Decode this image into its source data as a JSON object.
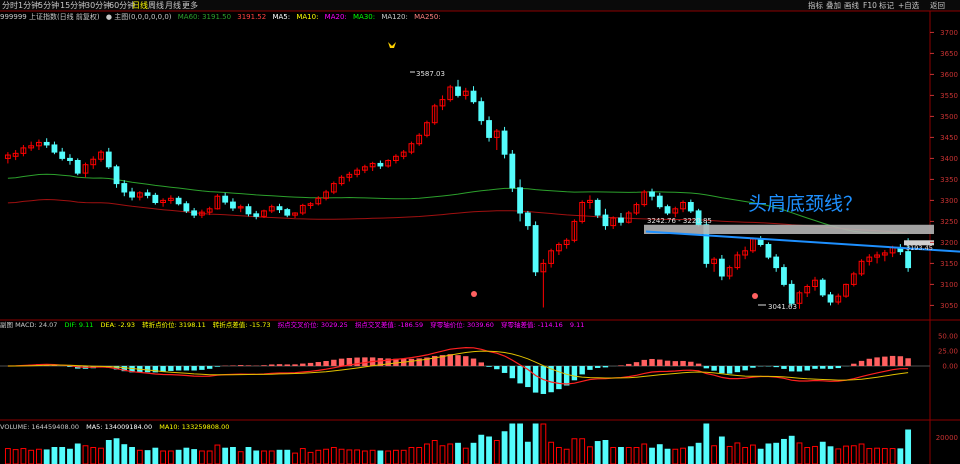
{
  "toolbar": {
    "items": [
      "分时",
      "1分钟",
      "5分钟",
      "15分钟",
      "30分钟",
      "60分钟",
      "日线",
      "周线",
      "月线",
      "更多"
    ],
    "active": "日线",
    "right_buttons": [
      "指标",
      "叠加",
      "画线",
      "F10",
      "标记",
      "+自选",
      "返回"
    ]
  },
  "price_info": {
    "code_name": "999999 上证指数(日线 前复权)",
    "main_label": "● 主图(0,0,0,0,0,0)",
    "ma60": "MA60: 3191.50",
    "ma_val2": "3191.52",
    "ma5": "MA5:",
    "ma10": "MA10:",
    "ma20": "MA20:",
    "ma30": "MA30:",
    "ma120": "MA120:",
    "ma250": "MA250:"
  },
  "annotation": {
    "text": "头肩底颈线？",
    "high_label": "3587.03",
    "low_label": "3041.63",
    "box_label": "3242.76 - 3220.85",
    "last_label": "3193.45"
  },
  "macd_info": {
    "name": "副图 MACD: 24.07",
    "dif": "DIF: 9.11",
    "dea": "DEA: -2.93",
    "t1": "转折点价位: 3198.11",
    "t2": "转折点差值: -15.73",
    "t3": "拐点交叉价位: 3029.25",
    "t4": "拐点交叉差值: -186.59",
    "t5": "穿零轴价位: 3039.60",
    "t6": "穿零轴差值: -114.16",
    "t7": "9.11"
  },
  "vol_info": {
    "volume": "VOLUME: 164459408.00",
    "ma5": "MA5: 134009184.00",
    "ma10": "MA10: 133259808.00"
  },
  "colors": {
    "up": "#ff0000",
    "down": "#54fcfc",
    "ma_long": "#2ca02c",
    "ma_mid": "#a01010",
    "neckline": "#1e90ff",
    "annotation": "#1e90ff"
  },
  "chart_data": {
    "type": "candlestick",
    "price_axis": {
      "ticks": [
        3050,
        3100,
        3150,
        3200,
        3250,
        3300,
        3350,
        3400,
        3450,
        3500,
        3550,
        3600,
        3650,
        3700
      ],
      "ylim": [
        3020,
        3720
      ]
    },
    "macd_axis": {
      "ticks": [
        50.0,
        25.0,
        0.0
      ],
      "tick_labels": [
        "50.00",
        "25.00",
        "0.00"
      ]
    },
    "volume_axis": {
      "ticks": [
        20000
      ],
      "tick_labels": [
        "20000"
      ]
    },
    "candles": [
      [
        3400,
        3415,
        3388,
        3408
      ],
      [
        3405,
        3420,
        3396,
        3412
      ],
      [
        3412,
        3432,
        3405,
        3425
      ],
      [
        3425,
        3440,
        3418,
        3430
      ],
      [
        3430,
        3445,
        3420,
        3438
      ],
      [
        3438,
        3448,
        3425,
        3432
      ],
      [
        3432,
        3440,
        3410,
        3415
      ],
      [
        3415,
        3425,
        3395,
        3400
      ],
      [
        3400,
        3410,
        3385,
        3395
      ],
      [
        3395,
        3400,
        3360,
        3365
      ],
      [
        3365,
        3390,
        3355,
        3385
      ],
      [
        3385,
        3405,
        3375,
        3398
      ],
      [
        3398,
        3420,
        3392,
        3415
      ],
      [
        3415,
        3425,
        3375,
        3380
      ],
      [
        3380,
        3385,
        3330,
        3340
      ],
      [
        3340,
        3348,
        3310,
        3320
      ],
      [
        3320,
        3330,
        3300,
        3308
      ],
      [
        3308,
        3322,
        3300,
        3318
      ],
      [
        3318,
        3326,
        3305,
        3312
      ],
      [
        3312,
        3318,
        3290,
        3295
      ],
      [
        3295,
        3305,
        3285,
        3300
      ],
      [
        3300,
        3312,
        3292,
        3305
      ],
      [
        3305,
        3310,
        3288,
        3292
      ],
      [
        3292,
        3298,
        3270,
        3275
      ],
      [
        3275,
        3282,
        3258,
        3265
      ],
      [
        3265,
        3278,
        3258,
        3272
      ],
      [
        3272,
        3285,
        3265,
        3280
      ],
      [
        3280,
        3315,
        3278,
        3310
      ],
      [
        3310,
        3318,
        3290,
        3296
      ],
      [
        3296,
        3305,
        3275,
        3282
      ],
      [
        3282,
        3290,
        3272,
        3285
      ],
      [
        3285,
        3292,
        3262,
        3268
      ],
      [
        3268,
        3275,
        3255,
        3262
      ],
      [
        3262,
        3278,
        3258,
        3275
      ],
      [
        3275,
        3290,
        3270,
        3285
      ],
      [
        3285,
        3292,
        3270,
        3278
      ],
      [
        3278,
        3282,
        3260,
        3265
      ],
      [
        3265,
        3272,
        3258,
        3270
      ],
      [
        3270,
        3292,
        3265,
        3288
      ],
      [
        3288,
        3296,
        3280,
        3292
      ],
      [
        3292,
        3310,
        3288,
        3305
      ],
      [
        3305,
        3325,
        3300,
        3320
      ],
      [
        3320,
        3345,
        3315,
        3340
      ],
      [
        3340,
        3360,
        3335,
        3355
      ],
      [
        3355,
        3368,
        3345,
        3362
      ],
      [
        3362,
        3378,
        3355,
        3372
      ],
      [
        3372,
        3385,
        3365,
        3380
      ],
      [
        3380,
        3392,
        3370,
        3388
      ],
      [
        3388,
        3395,
        3375,
        3382
      ],
      [
        3382,
        3398,
        3378,
        3395
      ],
      [
        3395,
        3410,
        3388,
        3405
      ],
      [
        3405,
        3420,
        3398,
        3415
      ],
      [
        3415,
        3440,
        3410,
        3435
      ],
      [
        3435,
        3460,
        3430,
        3455
      ],
      [
        3455,
        3490,
        3450,
        3485
      ],
      [
        3485,
        3530,
        3480,
        3525
      ],
      [
        3525,
        3550,
        3515,
        3540
      ],
      [
        3540,
        3575,
        3535,
        3570
      ],
      [
        3570,
        3587,
        3545,
        3550
      ],
      [
        3550,
        3568,
        3540,
        3560
      ],
      [
        3560,
        3572,
        3530,
        3535
      ],
      [
        3535,
        3545,
        3480,
        3490
      ],
      [
        3490,
        3500,
        3440,
        3450
      ],
      [
        3450,
        3470,
        3420,
        3465
      ],
      [
        3465,
        3475,
        3400,
        3410
      ],
      [
        3410,
        3420,
        3320,
        3330
      ],
      [
        3330,
        3350,
        3250,
        3270
      ],
      [
        3270,
        3275,
        3230,
        3240
      ],
      [
        3240,
        3250,
        3120,
        3130
      ],
      [
        3130,
        3160,
        3045,
        3150
      ],
      [
        3150,
        3185,
        3140,
        3180
      ],
      [
        3180,
        3200,
        3170,
        3195
      ],
      [
        3195,
        3210,
        3185,
        3205
      ],
      [
        3205,
        3255,
        3200,
        3250
      ],
      [
        3250,
        3300,
        3245,
        3295
      ],
      [
        3295,
        3312,
        3280,
        3300
      ],
      [
        3300,
        3305,
        3258,
        3265
      ],
      [
        3265,
        3280,
        3230,
        3240
      ],
      [
        3240,
        3262,
        3232,
        3258
      ],
      [
        3258,
        3270,
        3240,
        3248
      ],
      [
        3248,
        3275,
        3245,
        3270
      ],
      [
        3270,
        3295,
        3265,
        3290
      ],
      [
        3290,
        3325,
        3285,
        3320
      ],
      [
        3320,
        3328,
        3300,
        3310
      ],
      [
        3310,
        3318,
        3280,
        3285
      ],
      [
        3285,
        3290,
        3265,
        3270
      ],
      [
        3270,
        3285,
        3260,
        3280
      ],
      [
        3280,
        3300,
        3272,
        3295
      ],
      [
        3295,
        3302,
        3270,
        3275
      ],
      [
        3275,
        3280,
        3238,
        3242
      ],
      [
        3242,
        3250,
        3140,
        3150
      ],
      [
        3150,
        3165,
        3130,
        3160
      ],
      [
        3160,
        3170,
        3110,
        3120
      ],
      [
        3120,
        3145,
        3112,
        3140
      ],
      [
        3140,
        3178,
        3135,
        3170
      ],
      [
        3170,
        3190,
        3160,
        3180
      ],
      [
        3180,
        3212,
        3175,
        3208
      ],
      [
        3208,
        3215,
        3190,
        3195
      ],
      [
        3195,
        3200,
        3160,
        3165
      ],
      [
        3165,
        3172,
        3130,
        3140
      ],
      [
        3140,
        3148,
        3095,
        3100
      ],
      [
        3100,
        3110,
        3048,
        3055
      ],
      [
        3055,
        3085,
        3042,
        3080
      ],
      [
        3080,
        3100,
        3070,
        3095
      ],
      [
        3095,
        3118,
        3085,
        3110
      ],
      [
        3110,
        3115,
        3070,
        3075
      ],
      [
        3075,
        3082,
        3050,
        3058
      ],
      [
        3058,
        3078,
        3052,
        3072
      ],
      [
        3072,
        3102,
        3068,
        3100
      ],
      [
        3100,
        3130,
        3095,
        3125
      ],
      [
        3125,
        3160,
        3120,
        3155
      ],
      [
        3155,
        3172,
        3145,
        3165
      ],
      [
        3165,
        3178,
        3150,
        3170
      ],
      [
        3170,
        3182,
        3155,
        3175
      ],
      [
        3175,
        3192,
        3165,
        3188
      ],
      [
        3188,
        3196,
        3170,
        3178
      ],
      [
        3178,
        3210,
        3130,
        3140
      ]
    ]
  }
}
